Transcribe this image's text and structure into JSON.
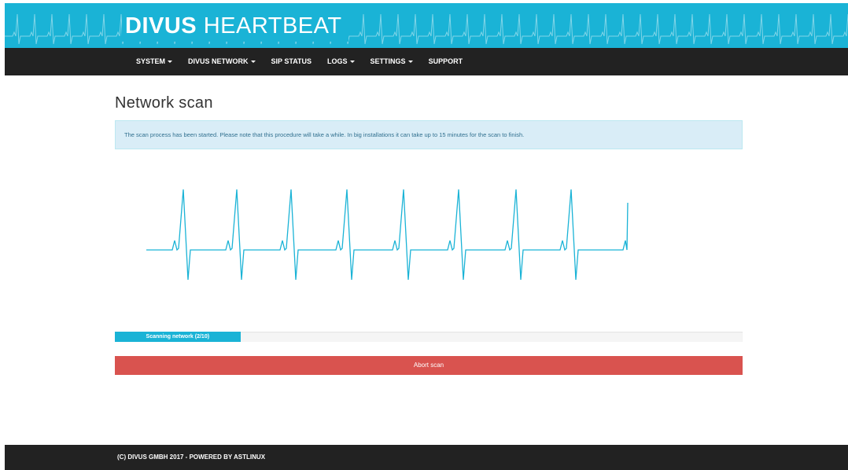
{
  "brand": {
    "bold": "DIVUS",
    "light": "HEARTBEAT"
  },
  "nav": {
    "items": [
      {
        "label": "SYSTEM",
        "dropdown": true
      },
      {
        "label": "DIVUS NETWORK",
        "dropdown": true
      },
      {
        "label": "SIP STATUS",
        "dropdown": false
      },
      {
        "label": "LOGS",
        "dropdown": true
      },
      {
        "label": "SETTINGS",
        "dropdown": true
      },
      {
        "label": "SUPPORT",
        "dropdown": false
      }
    ]
  },
  "main": {
    "title": "Network scan",
    "alert": "The scan process has been started. Please note that this procedure will take a while. In big installations it can take up to 15 minutes for the scan to finish.",
    "progress": {
      "label": "Scanning network (2/10)",
      "current": 2,
      "total": 10
    },
    "abort_label": "Abort scan"
  },
  "footer": {
    "text": "(C) DIVUS GMBH 2017 - POWERED BY ASTLINUX"
  },
  "colors": {
    "accent": "#1ab3d6",
    "navbar": "#222222",
    "danger": "#d9534f",
    "alert_bg": "#d9edf7",
    "alert_text": "#31708f"
  },
  "icons": {
    "dropdown": "caret-down-icon",
    "heartbeat": "heartbeat-line-icon"
  }
}
